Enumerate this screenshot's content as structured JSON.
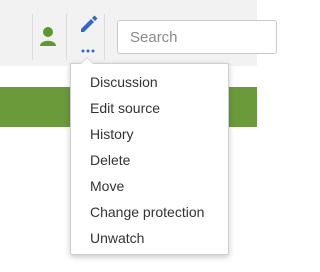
{
  "toolbar": {
    "search": {
      "placeholder": "Search",
      "value": ""
    },
    "user_icon": "user-icon",
    "edit_icon": "pencil-icon",
    "more_icon": "ellipsis-icon"
  },
  "menu": {
    "items": [
      {
        "label": "Discussion"
      },
      {
        "label": "Edit source"
      },
      {
        "label": "History"
      },
      {
        "label": "Delete"
      },
      {
        "label": "Move"
      },
      {
        "label": "Change protection"
      },
      {
        "label": "Unwatch"
      }
    ]
  },
  "colors": {
    "accent": "#3366cc",
    "user_icon": "#5a9a2a",
    "banner": "#6b9a3a",
    "toolbar_bg": "#f2f2f2"
  }
}
